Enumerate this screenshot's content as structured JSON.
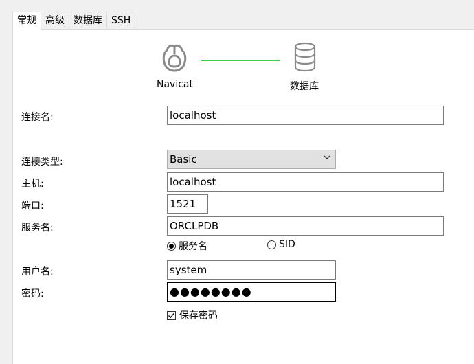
{
  "tabs": [
    {
      "label": "常规",
      "active": true
    },
    {
      "label": "高级",
      "active": false
    },
    {
      "label": "数据库",
      "active": false
    },
    {
      "label": "SSH",
      "active": false
    }
  ],
  "diagram": {
    "left_label": "Navicat",
    "right_label": "数据库",
    "left_icon": "navicat-logo-icon",
    "right_icon": "database-icon",
    "line_color": "#3ccf4e"
  },
  "form": {
    "connection_name_label": "连接名:",
    "connection_name_value": "localhost",
    "connection_type_label": "连接类型:",
    "connection_type_value": "Basic",
    "host_label": "主机:",
    "host_value": "localhost",
    "port_label": "端口:",
    "port_value": "1521",
    "service_name_label": "服务名:",
    "service_name_value": "ORCLPDB",
    "radio_service_name": "服务名",
    "radio_sid": "SID",
    "selected_radio": "service_name",
    "username_label": "用户名:",
    "username_value": "system",
    "password_label": "密码:",
    "password_value": "●●●●●●●●",
    "save_password_label": "保存密码",
    "save_password_checked": true
  }
}
